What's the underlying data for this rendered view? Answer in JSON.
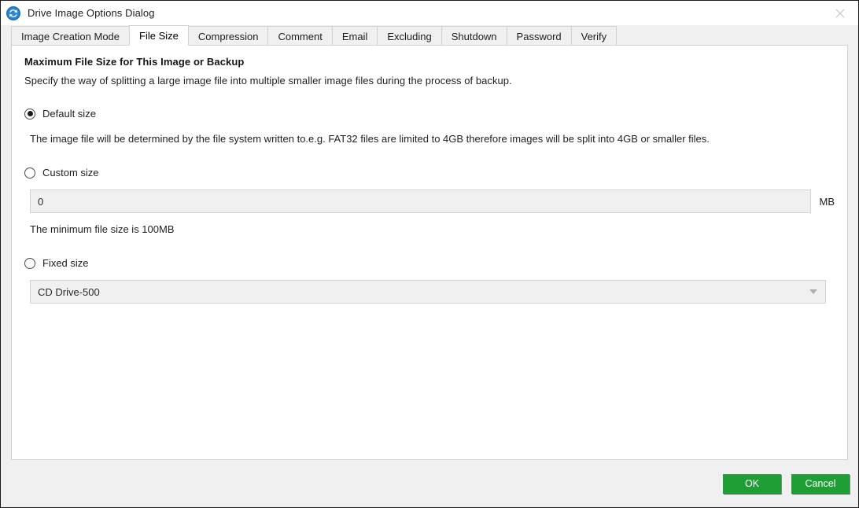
{
  "window": {
    "title": "Drive Image Options Dialog",
    "icon": "sync-arrows-icon",
    "close_icon": "close-icon"
  },
  "tabs": [
    {
      "label": "Image Creation Mode",
      "active": false
    },
    {
      "label": "File Size",
      "active": true
    },
    {
      "label": "Compression",
      "active": false
    },
    {
      "label": "Comment",
      "active": false
    },
    {
      "label": "Email",
      "active": false
    },
    {
      "label": "Excluding",
      "active": false
    },
    {
      "label": "Shutdown",
      "active": false
    },
    {
      "label": "Password",
      "active": false
    },
    {
      "label": "Verify",
      "active": false
    }
  ],
  "content": {
    "heading": "Maximum File Size for This Image or Backup",
    "subheading": "Specify the way of splitting a large image file into multiple smaller image files during the process of backup.",
    "default_option": {
      "label": "Default size",
      "selected": true,
      "description": "The image file will be determined by the file system written to.e.g. FAT32 files are limited to 4GB therefore images will be split into 4GB or smaller files."
    },
    "custom_option": {
      "label": "Custom size",
      "selected": false,
      "input_value": "0",
      "input_placeholder": "0",
      "unit": "MB",
      "hint": "The minimum file size is 100MB"
    },
    "fixed_option": {
      "label": "Fixed size",
      "selected": false,
      "selected_value": "CD Drive-500",
      "options": [
        "CD Drive-500"
      ],
      "arrow_icon": "chevron-down-icon"
    }
  },
  "footer": {
    "ok_label": "OK",
    "cancel_label": "Cancel",
    "button_color": "#1f9e35"
  }
}
